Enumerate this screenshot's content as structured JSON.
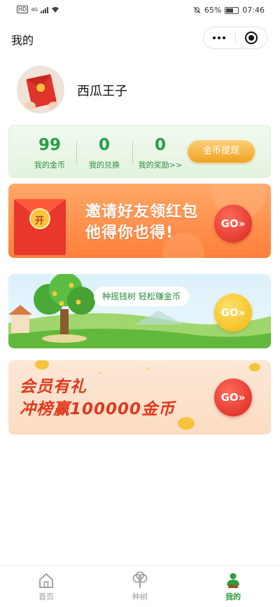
{
  "status_bar": {
    "hd": "HD",
    "network": "4G",
    "battery_percent": "65%",
    "time": "07:46",
    "battery_level": 0.65
  },
  "nav": {
    "title": "我的"
  },
  "profile": {
    "username": "西瓜王子"
  },
  "stats": {
    "items": [
      {
        "value": "99",
        "label": "我的金币"
      },
      {
        "value": "0",
        "label": "我的兑换"
      },
      {
        "value": "0",
        "label": "我的奖励>>"
      }
    ],
    "withdraw_label": "金币提现"
  },
  "banners": {
    "invite": {
      "envelope_char": "开",
      "line1": "邀请好友领红包",
      "line2": "他得你也得!",
      "go": "GO»"
    },
    "tree": {
      "pill_text": "种摇钱树  轻松赚金币",
      "go": "GO»"
    },
    "member": {
      "line1": "会员有礼",
      "line2": "冲榜赢100000金币",
      "go": "GO»"
    }
  },
  "tab_bar": {
    "tabs": [
      {
        "label": "首页",
        "icon": "home-icon",
        "active": false
      },
      {
        "label": "种树",
        "icon": "tree-icon",
        "active": false
      },
      {
        "label": "我的",
        "icon": "user-icon",
        "active": true
      }
    ]
  },
  "colors": {
    "accent_green": "#27a047",
    "tab_active": "#2e9d3c",
    "invite_orange": "#ff7f3a",
    "go_red": "#d8261f",
    "go_yellow": "#f4b60f"
  }
}
